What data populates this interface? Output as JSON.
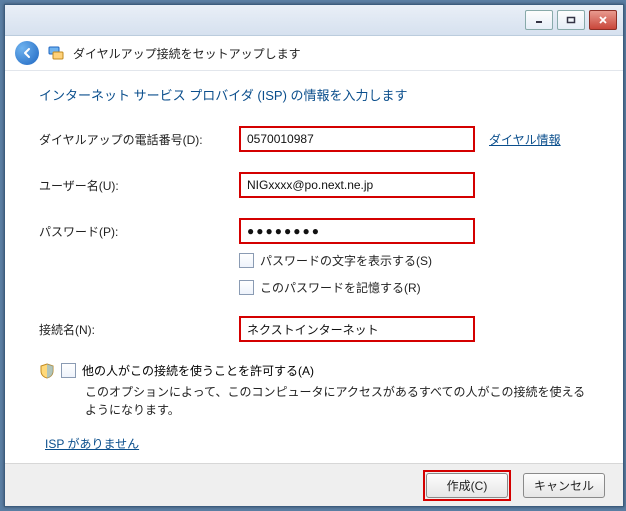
{
  "window": {
    "title": "ダイヤルアップ接続をセットアップします"
  },
  "instruction": "インターネット サービス プロバイダ (ISP) の情報を入力します",
  "labels": {
    "phone": "ダイヤルアップの電話番号(D):",
    "user": "ユーザー名(U):",
    "password": "パスワード(P):",
    "connection": "接続名(N):"
  },
  "values": {
    "phone": "0570010987",
    "user": "NIGxxxx@po.next.ne.jp",
    "password_mask": "●●●●●●●●",
    "connection": "ネクストインターネット"
  },
  "links": {
    "dial_info": "ダイヤル情報",
    "no_isp": "ISP がありません"
  },
  "checkboxes": {
    "show_pw": "パスワードの文字を表示する(S)",
    "remember_pw": "このパスワードを記憶する(R)",
    "allow_others": "他の人がこの接続を使うことを許可する(A)"
  },
  "note": "このオプションによって、このコンピュータにアクセスがあるすべての人がこの接続を使えるようになります。",
  "buttons": {
    "create": "作成(C)",
    "cancel": "キャンセル"
  }
}
